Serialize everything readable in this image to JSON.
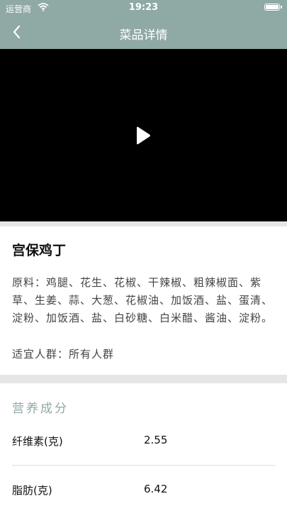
{
  "status": {
    "carrier": "运营商",
    "time": "19:23"
  },
  "nav": {
    "title": "菜品详情"
  },
  "dish": {
    "name": "宫保鸡丁",
    "ingredients": "原料：鸡腿、花生、花椒、干辣椒、粗辣椒面、紫草、生姜、蒜、大葱、花椒油、加饭酒、盐、蛋清、淀粉、加饭酒、盐、白砂糖、白米醋、酱油、淀粉。",
    "suitable": "适宜人群：所有人群"
  },
  "nutrition": {
    "title": "营养成分",
    "rows": [
      {
        "name": "纤维素(克)",
        "value": "2.55"
      },
      {
        "name": "脂肪(克)",
        "value": "6.42"
      }
    ]
  },
  "icons": {
    "back": "chevron-left-icon",
    "play": "play-icon",
    "wifi": "wifi-icon",
    "battery": "battery-icon"
  },
  "colors": {
    "header": "#8fa9a5",
    "accent": "#8fa9a5",
    "divider": "#e6e6e6",
    "video": "#000000"
  }
}
